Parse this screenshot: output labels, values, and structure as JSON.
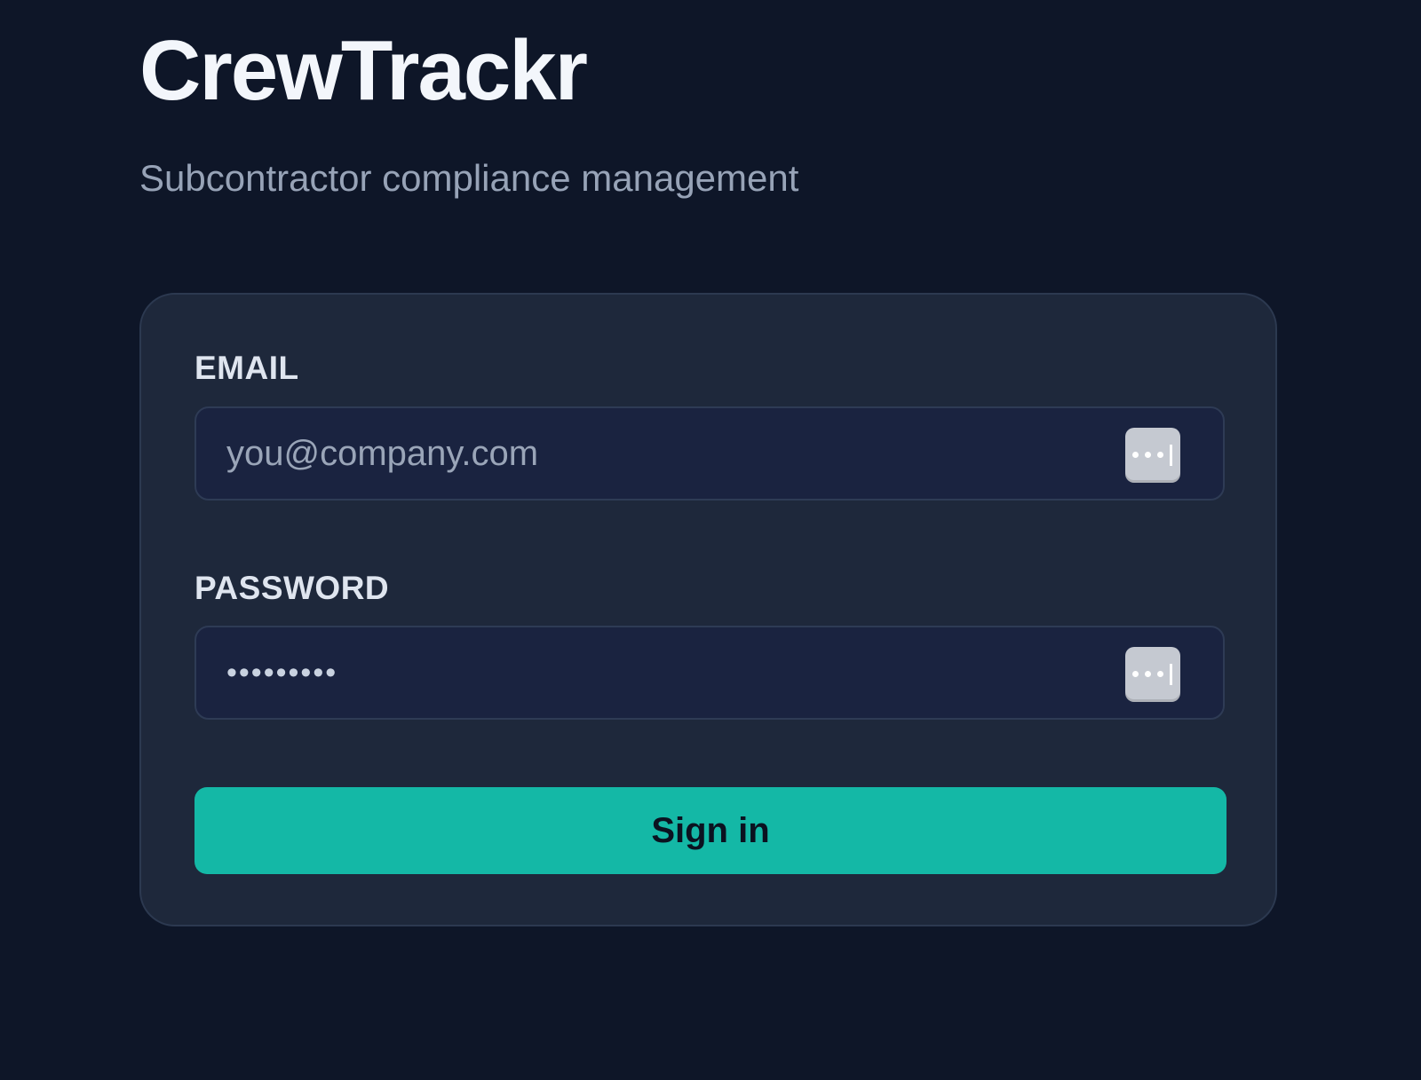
{
  "app": {
    "title": "CrewTrackr",
    "subtitle": "Subcontractor compliance management"
  },
  "form": {
    "email": {
      "label": "EMAIL",
      "placeholder": "you@company.com",
      "value": ""
    },
    "password": {
      "label": "PASSWORD",
      "value": "•••••••••"
    },
    "submit_label": "Sign in"
  },
  "icons": {
    "password_manager": "password-manager-icon"
  },
  "colors": {
    "background": "#0e1628",
    "card": "#1e283b",
    "input": "#1a2340",
    "accent": "#14b8a6",
    "title": "#f3f6fb",
    "subtitle": "#97a3b7"
  }
}
